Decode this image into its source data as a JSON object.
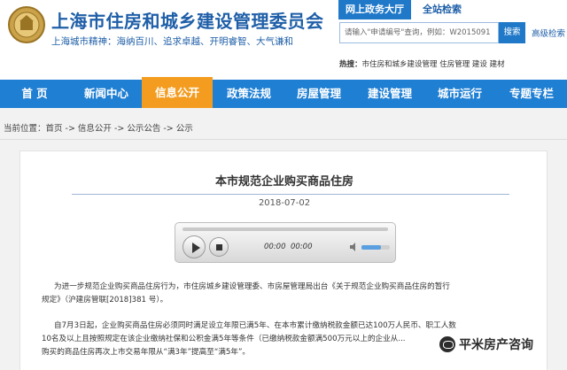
{
  "header": {
    "site_title": "上海市住房和城乡建设管理委员会",
    "motto": "上海城市精神：海纳百川、追求卓越、开明睿智、大气谦和",
    "tab_gov": "网上政务大厅",
    "tab_search": "全站检索",
    "search_value": "请输入\"申请编号\"查询，例如：W2015091",
    "search_button": "搜索",
    "advanced_search": "高级检索",
    "hot_label": "热搜：",
    "hot_items": "市住房和城乡建设管理  住房管理  建设  建材"
  },
  "nav": {
    "items": [
      "首  页",
      "新闻中心",
      "信息公开",
      "政策法规",
      "房屋管理",
      "建设管理",
      "城市运行",
      "专题专栏"
    ],
    "active_index": 2
  },
  "breadcrumb": "当前位置：首页 -> 信息公开 -> 公示公告 -> 公示",
  "article": {
    "title": "本市规范企业购买商品住房",
    "date": "2018-07-02",
    "player": {
      "current_time": "00:00",
      "duration": "00:00",
      "volume_fraction": 0.7
    },
    "paragraphs": [
      "为进一步规范企业购买商品住房行为，市住房城乡建设管理委、市房屋管理局出台《关于规范企业购买商品住房的暂行",
      "规定》（沪建房管联[2018]381 号）。",
      "自7月3日起，企业购买商品住房必须同时满足设立年限已满5年、在本市累计缴纳税款金额已达100万人民币、职工人数",
      "10名及以上且按照规定在该企业缴纳社保和公积金满5年等条件（已缴纳税款金额满500万元以上的企业从...",
      "购买的商品住房再次上市交易年限从“满3年”提高至“满5年”。"
    ]
  },
  "watermark": "平米房产咨询",
  "colors": {
    "brand_blue": "#1f7fd3",
    "active_orange": "#f39c1f"
  }
}
